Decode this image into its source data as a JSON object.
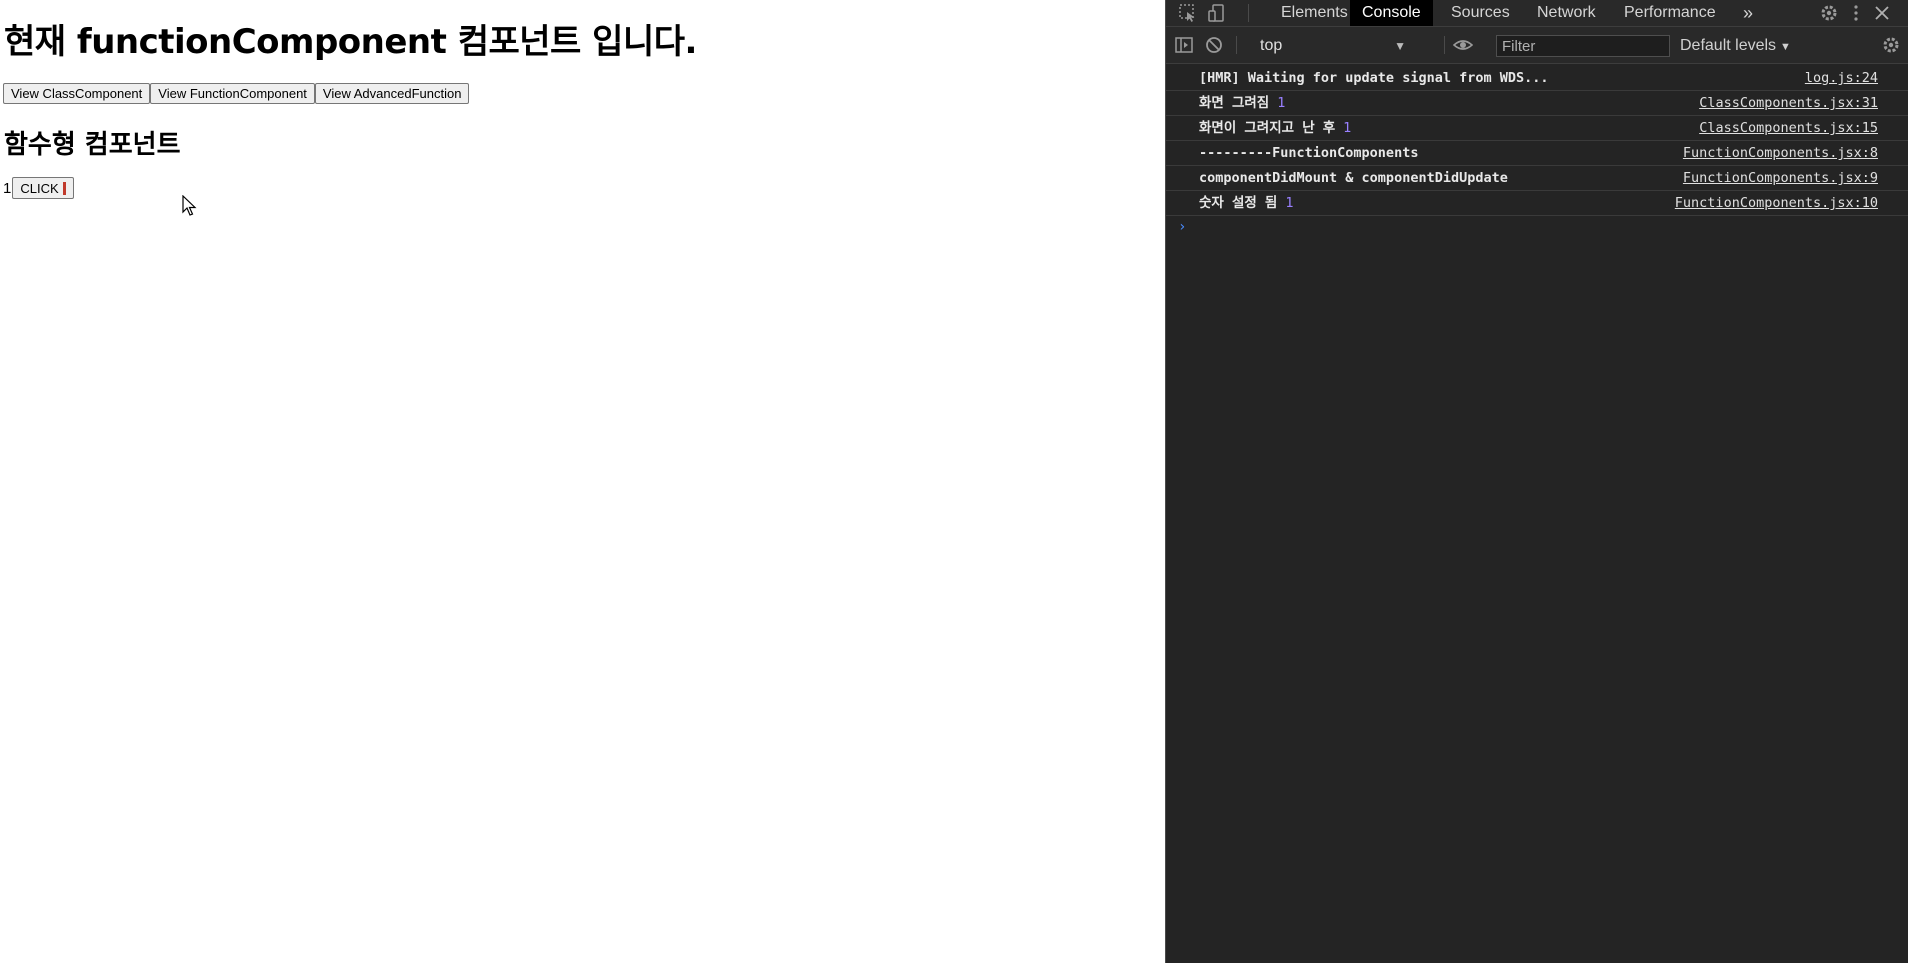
{
  "page": {
    "title": "현재 functionComponent 컴포넌트 입니다.",
    "buttons": [
      "View ClassComponent",
      "View FunctionComponent",
      "View AdvancedFunction"
    ],
    "section_title": "함수형 컴포넌트",
    "count": "1",
    "click_label": "CLICK"
  },
  "devtools": {
    "tabs": [
      "Elements",
      "Console",
      "Sources",
      "Network",
      "Performance"
    ],
    "active_tab": "Console",
    "more_tabs": "»",
    "context": "top",
    "filter_placeholder": "Filter",
    "levels": "Default levels",
    "logs": [
      {
        "msg": "[HMR] Waiting for update signal from WDS...",
        "num": "",
        "src": "log.js:24"
      },
      {
        "msg": "화면 그려짐",
        "num": "1",
        "src": "ClassComponents.jsx:31"
      },
      {
        "msg": "화면이 그려지고 난 후",
        "num": "1",
        "src": "ClassComponents.jsx:15"
      },
      {
        "msg": "---------FunctionComponents",
        "num": "",
        "src": "FunctionComponents.jsx:8"
      },
      {
        "msg": "componentDidMount & componentDidUpdate",
        "num": "",
        "src": "FunctionComponents.jsx:9"
      },
      {
        "msg": "숫자 설정 됨",
        "num": "1",
        "src": "FunctionComponents.jsx:10"
      }
    ],
    "prompt_symbol": "›"
  },
  "colors": {
    "devtools_bg": "#242424",
    "active_tab_bg": "#000000",
    "number_color": "#9980ff",
    "prompt_color": "#4a8cff"
  }
}
